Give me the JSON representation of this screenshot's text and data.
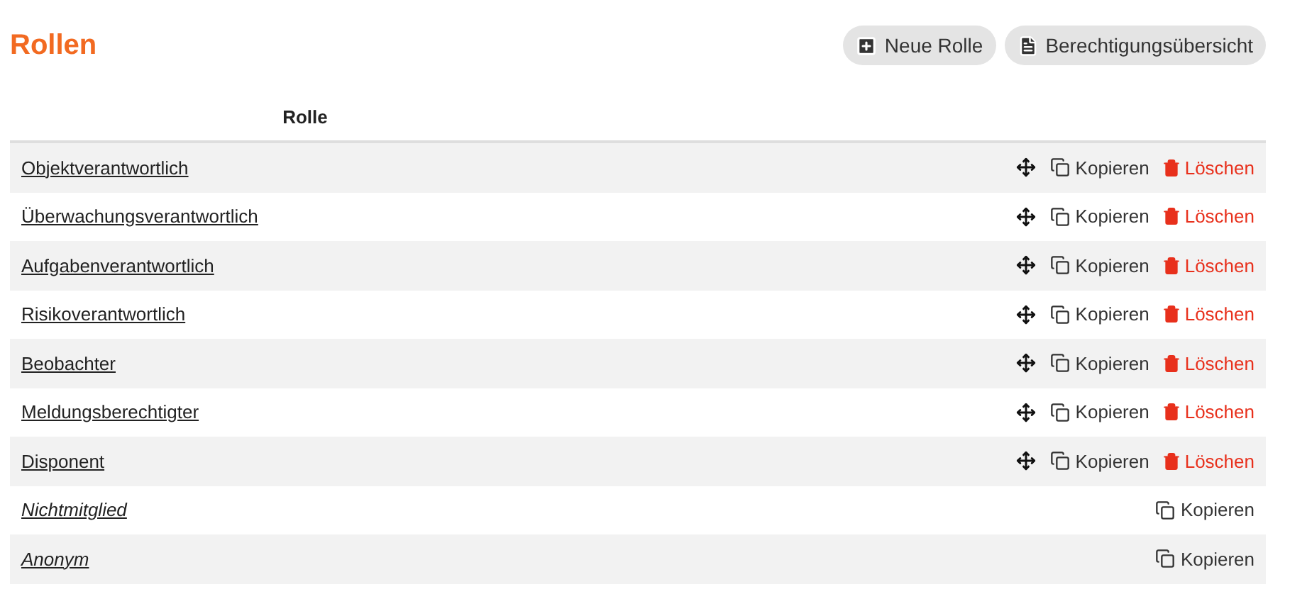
{
  "title": "Rollen",
  "buttons": [
    {
      "kind": "add",
      "label": "Neue Rolle"
    },
    {
      "kind": "document",
      "label": "Berechtigungsübersicht"
    }
  ],
  "table": {
    "columns": [
      "Rolle"
    ],
    "rows": [
      {
        "name": "Objektverantwortlich",
        "kind": "custom",
        "copy": "Kopieren",
        "delete": "Löschen"
      },
      {
        "name": "Überwachungsverantwortlich",
        "kind": "custom",
        "copy": "Kopieren",
        "delete": "Löschen"
      },
      {
        "name": "Aufgabenverantwortlich",
        "kind": "custom",
        "copy": "Kopieren",
        "delete": "Löschen"
      },
      {
        "name": "Risikoverantwortlich",
        "kind": "custom",
        "copy": "Kopieren",
        "delete": "Löschen"
      },
      {
        "name": "Beobachter",
        "kind": "custom",
        "copy": "Kopieren",
        "delete": "Löschen"
      },
      {
        "name": "Meldungsberechtigter",
        "kind": "custom",
        "copy": "Kopieren",
        "delete": "Löschen"
      },
      {
        "name": "Disponent",
        "kind": "custom",
        "copy": "Kopieren",
        "delete": "Löschen"
      },
      {
        "name": "Nichtmitglied",
        "kind": "builtin",
        "copy": "Kopieren"
      },
      {
        "name": "Anonym",
        "kind": "builtin",
        "copy": "Kopieren"
      }
    ]
  }
}
